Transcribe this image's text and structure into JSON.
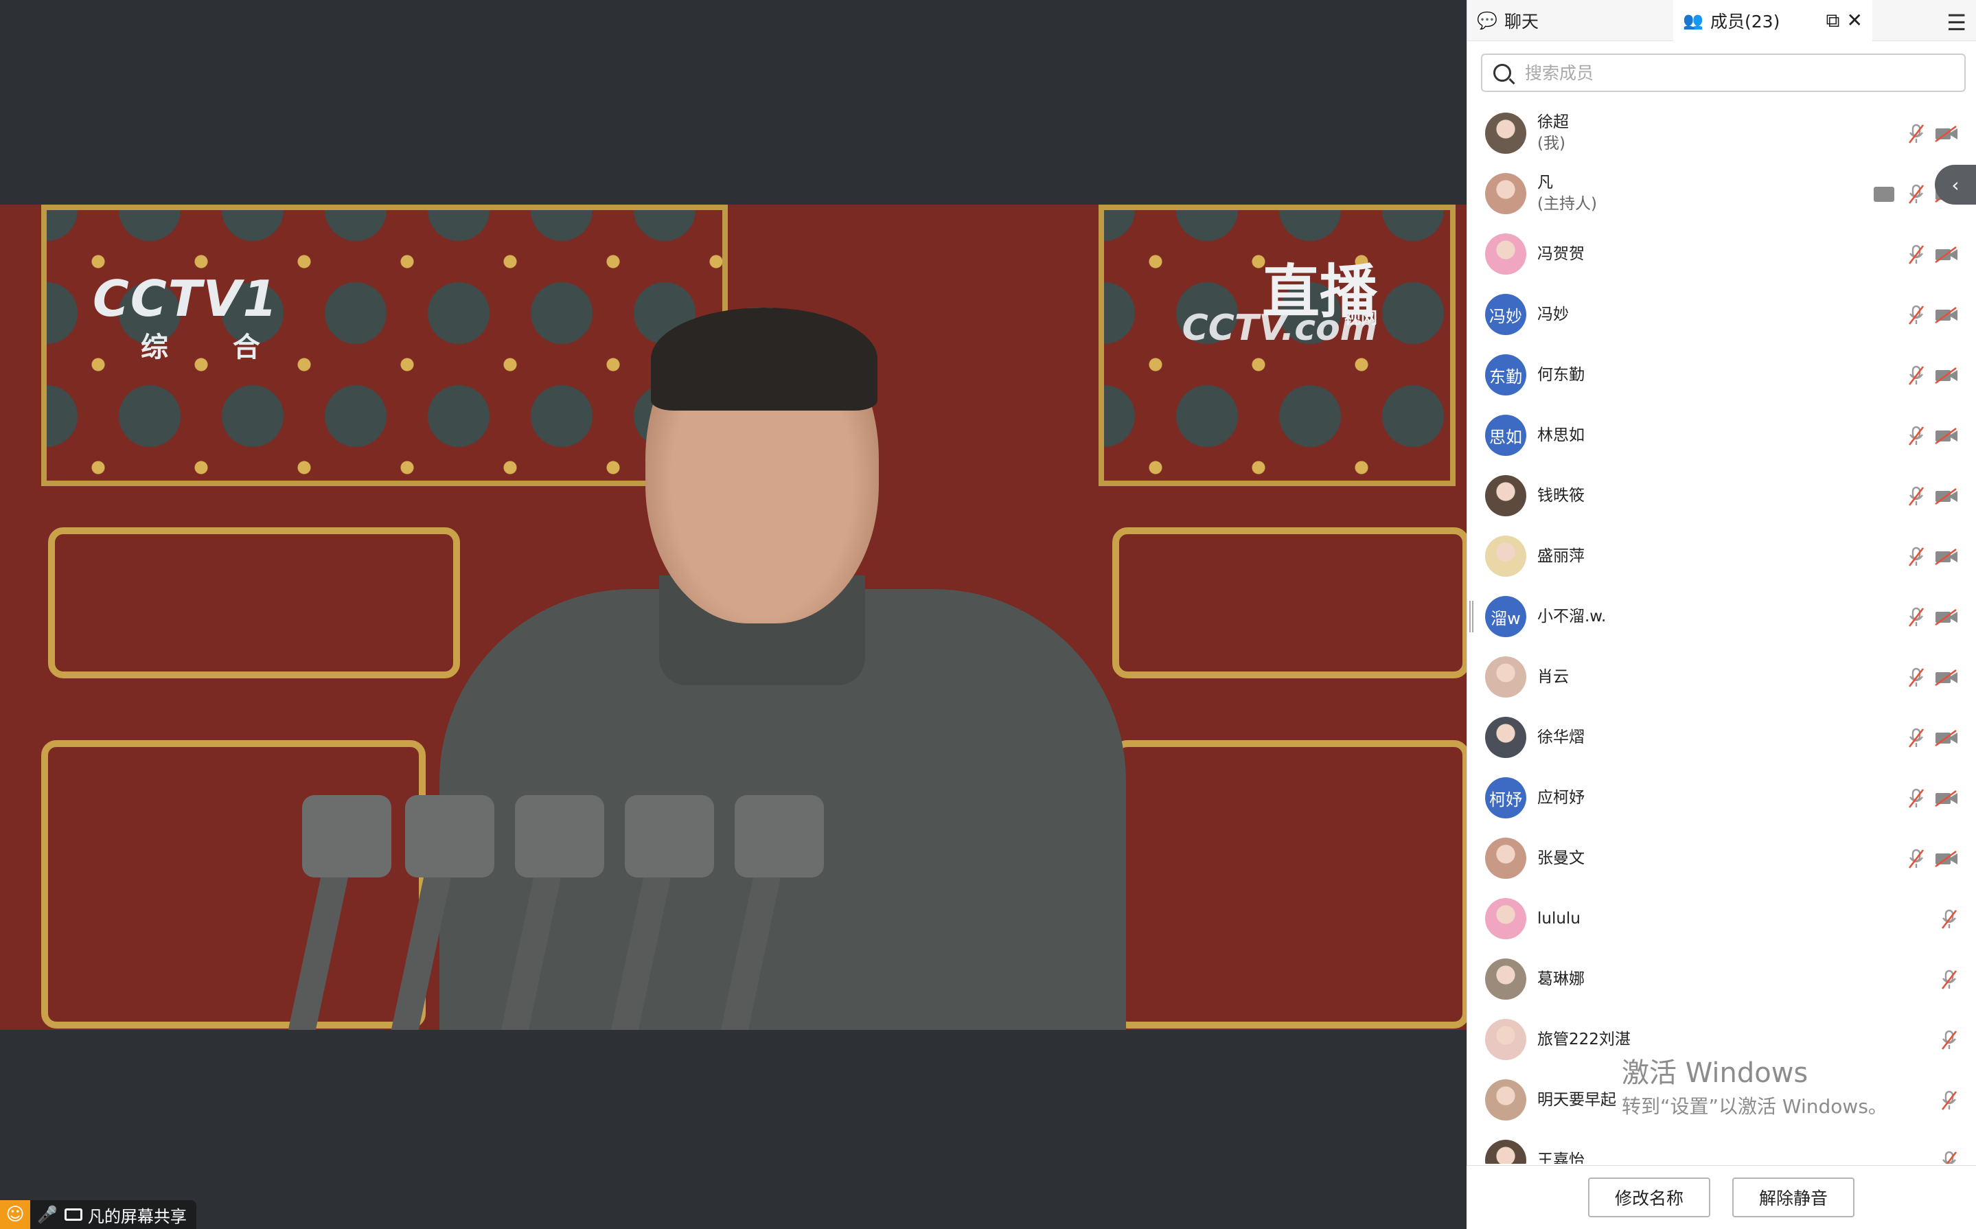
{
  "video": {
    "channel_logo": "CCTV1",
    "channel_sub": "综 合",
    "live_label": "直播",
    "live_site": "CCTV.com",
    "site_tag": "视网"
  },
  "share_status": {
    "label": "凡的屏幕共享"
  },
  "panel": {
    "tabs": {
      "chat": "聊天",
      "members": "成员(23)"
    },
    "search_placeholder": "搜索成员",
    "members": [
      {
        "name": "徐超",
        "role": "(我)",
        "avatar": "photo",
        "mic": "muted",
        "cam": "off"
      },
      {
        "name": "凡",
        "role": "(主持人)",
        "avatar": "photo",
        "mic": "muted",
        "cam": "off",
        "sharing": true
      },
      {
        "name": "冯贺贺",
        "avatar": "photo",
        "mic": "muted",
        "cam": "off"
      },
      {
        "name": "冯妙",
        "avatar_text": "冯妙",
        "mic": "muted",
        "cam": "off"
      },
      {
        "name": "何东勤",
        "avatar_text": "东勤",
        "mic": "muted",
        "cam": "off"
      },
      {
        "name": "林思如",
        "avatar_text": "思如",
        "mic": "muted",
        "cam": "off"
      },
      {
        "name": "钱昳筱",
        "avatar": "photo",
        "mic": "muted",
        "cam": "off"
      },
      {
        "name": "盛丽萍",
        "avatar": "photo",
        "mic": "muted",
        "cam": "off"
      },
      {
        "name": "小不溜.w.",
        "avatar_text": "溜w",
        "mic": "muted",
        "cam": "off"
      },
      {
        "name": "肖云",
        "avatar": "photo",
        "mic": "muted",
        "cam": "off"
      },
      {
        "name": "徐华熠",
        "avatar": "photo",
        "mic": "muted",
        "cam": "off"
      },
      {
        "name": "应柯妤",
        "avatar_text": "柯妤",
        "mic": "muted",
        "cam": "off"
      },
      {
        "name": "张曼文",
        "avatar": "photo",
        "mic": "muted",
        "cam": "off"
      },
      {
        "name": "lululu",
        "avatar": "photo",
        "mic": "muted"
      },
      {
        "name": "葛琳娜",
        "avatar": "photo",
        "mic": "muted"
      },
      {
        "name": "旅管222刘湛",
        "avatar": "photo",
        "mic": "muted"
      },
      {
        "name": "明天要早起",
        "avatar": "photo",
        "mic": "muted"
      },
      {
        "name": "王嘉怡",
        "avatar": "photo",
        "mic": "muted"
      }
    ],
    "buttons": {
      "rename": "修改名称",
      "unmute": "解除静音"
    }
  },
  "watermark": {
    "line1": "激活 Windows",
    "line2": "转到“设置”以激活 Windows。"
  },
  "colors": {
    "text_avatar": "#3d6bc3",
    "share_orange": "#f29b18",
    "background": "#2d3034"
  }
}
